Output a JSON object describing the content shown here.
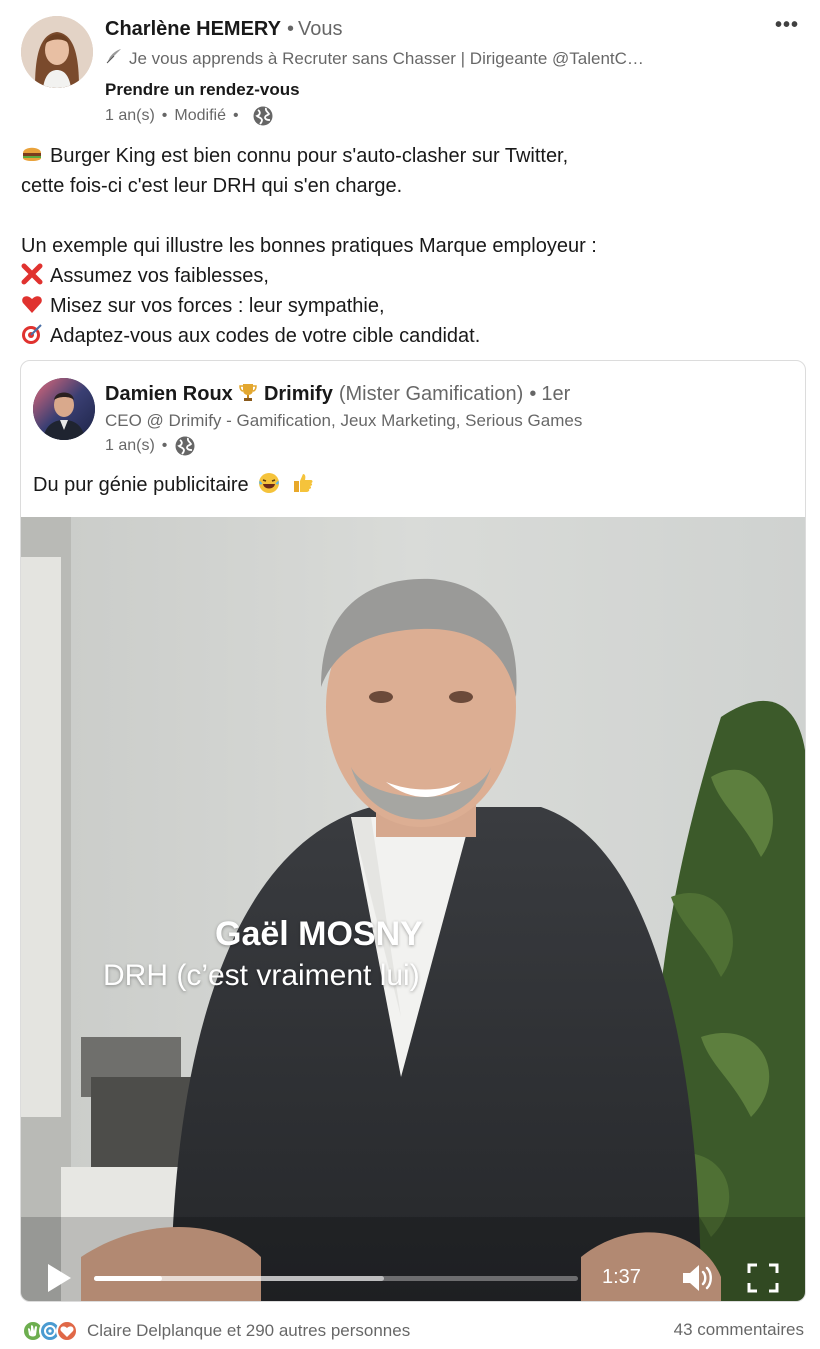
{
  "post": {
    "author": {
      "name": "Charlène HEMERY",
      "separator": "•",
      "relation": "Vous",
      "headline": "Je vous apprends à Recruter sans Chasser | Dirigeante @TalentC…",
      "headline_icon": "feather-icon",
      "cta": "Prendre un rendez-vous",
      "time": "1 an(s)",
      "edited": "Modifié",
      "visibility_icon": "globe-icon"
    },
    "more_icon": "•••",
    "commentary": {
      "line1": "Burger King est bien connu pour s'auto-clasher sur Twitter,",
      "line1_icon": "burger-emoji",
      "line2": "cette fois-ci c'est leur DRH qui s'en charge.",
      "line3": "Un exemple qui illustre les bonnes pratiques Marque employeur :",
      "line4": "Assumez vos faiblesses,",
      "line4_icon": "red-cross-emoji",
      "line5": "Misez sur vos forces : leur sympathie,",
      "line5_icon": "red-heart-emoji",
      "line6": "Adaptez-vous aux codes de votre cible candidat.",
      "line6_icon": "target-emoji"
    },
    "shared": {
      "author_name": "Damien Roux",
      "author_name_icon": "trophy-emoji",
      "author_company": "Drimify",
      "author_alias": "(Mister Gamification)",
      "separator": "•",
      "degree": "1er",
      "headline": "CEO @ Drimify - Gamification, Jeux Marketing, Serious Games",
      "time": "1 an(s)",
      "visibility_icon": "globe-icon",
      "text": "Du pur génie publicitaire",
      "text_icons": [
        "laughing-emoji",
        "thumbs-up-emoji"
      ],
      "video": {
        "overlay_name": "Gaël MOSNY",
        "overlay_role": "DRH (c’est vraiment lui)",
        "duration": "1:37",
        "progress": 0.14,
        "buffered": 0.6
      }
    },
    "social": {
      "reactions_text": "Claire Delplanque et 290 autres personnes",
      "reaction_icons": [
        "clap-icon",
        "insightful-icon",
        "love-icon"
      ],
      "comments": "43 commentaires"
    }
  }
}
